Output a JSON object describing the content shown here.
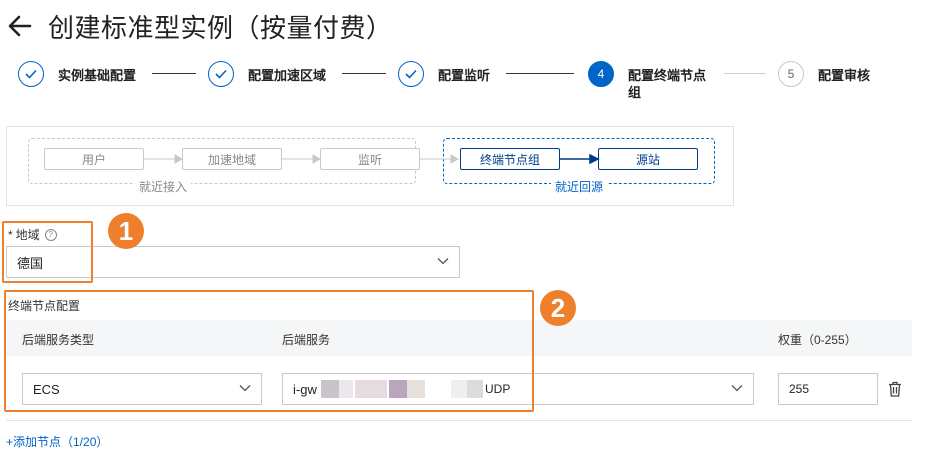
{
  "page": {
    "title": "创建标准型实例（按量付费）"
  },
  "steps": [
    {
      "label": "实例基础配置",
      "state": "done"
    },
    {
      "label": "配置加速区域",
      "state": "done"
    },
    {
      "label": "配置监听",
      "state": "done"
    },
    {
      "number": "4",
      "label": "配置终端节点组",
      "state": "active"
    },
    {
      "number": "5",
      "label": "配置审核",
      "state": "todo"
    }
  ],
  "diagram": {
    "user": "用户",
    "accel_region": "加速地域",
    "listener": "监听",
    "endpoint_group": "终端节点组",
    "origin": "源站",
    "nearby_access": "就近接入",
    "nearby_return": "就近回源"
  },
  "region_field": {
    "label": "地域",
    "required_mark": "*",
    "help_glyph": "?",
    "value": "德国"
  },
  "endpoint_config": {
    "section_label": "终端节点配置",
    "columns": {
      "backend_type": "后端服务类型",
      "backend_service": "后端服务",
      "weight": "权重（0-255）"
    },
    "row": {
      "backend_type_value": "ECS",
      "backend_service_prefix": "i-gw",
      "backend_service_suffix": "UDP",
      "weight_value": "255"
    },
    "add_node_label": "+添加节点（1/20）"
  },
  "annotations": {
    "badge_1": "1",
    "badge_2": "2",
    "color": "#ee7f2d"
  },
  "colors": {
    "primary": "#0064c8",
    "annotation": "#ee7f2d"
  }
}
